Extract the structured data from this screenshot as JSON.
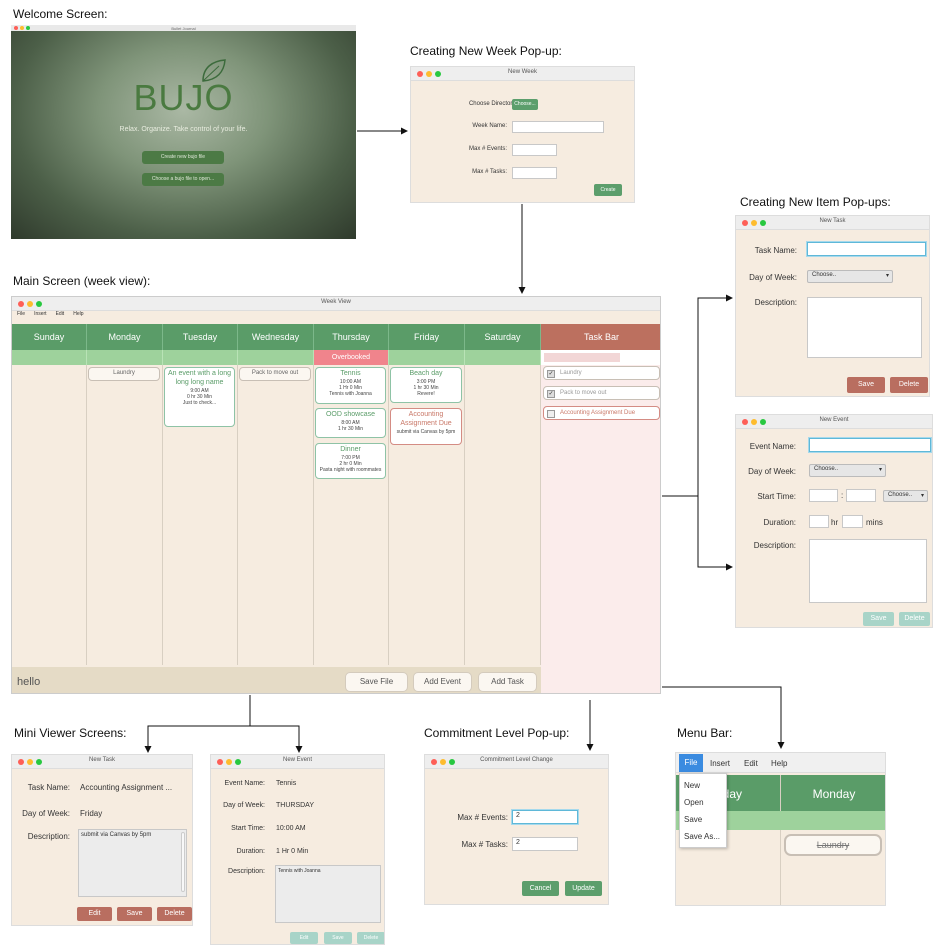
{
  "captions": {
    "welcome": "Welcome Screen:",
    "new_week": "Creating New Week Pop-up:",
    "new_item": "Creating New Item Pop-ups:",
    "main": "Main Screen (week view):",
    "mini": "Mini Viewer Screens:",
    "commit": "Commitment Level Pop-up:",
    "menu": "Menu Bar:"
  },
  "welcome": {
    "title": "Bullet Journal",
    "logo": "BUJO",
    "tagline": "Relax. Organize. Take control of your life.",
    "btn_create": "Create new bujo file",
    "btn_choose": "Choose a bujo file to open..."
  },
  "new_week": {
    "title": "New Week",
    "choose_dir_label": "Choose Directory:",
    "choose_btn": "Choose...",
    "week_name_label": "Week Name:",
    "max_events_label": "Max # Events:",
    "max_tasks_label": "Max # Tasks:",
    "create_btn": "Create"
  },
  "new_task": {
    "title": "New Task",
    "task_name_label": "Task Name:",
    "day_label": "Day of Week:",
    "day_value": "Choose..",
    "desc_label": "Description:",
    "save": "Save",
    "delete": "Delete"
  },
  "new_event": {
    "title": "New Event",
    "event_name_label": "Event Name:",
    "day_label": "Day of Week:",
    "day_value": "Choose..",
    "start_label": "Start Time:",
    "colon": ":",
    "ampm_value": "Choose..",
    "duration_label": "Duration:",
    "hr": "hr",
    "mins": "mins",
    "desc_label": "Description:",
    "save": "Save",
    "delete": "Delete"
  },
  "main": {
    "title": "Week View",
    "menu": [
      "File",
      "Insert",
      "Edit",
      "Help"
    ],
    "days": [
      "Sunday",
      "Monday",
      "Tuesday",
      "Wednesday",
      "Thursday",
      "Friday",
      "Saturday"
    ],
    "overbooked": "Overbooked",
    "taskbar_title": "Task Bar",
    "monday_tasks": [
      "Laundry"
    ],
    "tuesday_event": {
      "title": "An event with a long long long name",
      "time": "9:00 AM",
      "dur": "0 hr 30 Min",
      "desc": "Just to check..."
    },
    "wednesday_tasks": [
      "Pack to move out"
    ],
    "thursday_events": [
      {
        "title": "Tennis",
        "time": "10:00 AM",
        "dur": "1 Hr 0 Min",
        "desc": "Tennis with Joanna"
      },
      {
        "title": "OOD showcase",
        "time": "8:00 AM",
        "dur": "1 hr 30 Min",
        "desc": ""
      },
      {
        "title": "Dinner",
        "time": "7:00 PM",
        "dur": "2 hr 0 Min",
        "desc": "Pasta night with roommates"
      }
    ],
    "friday_event": {
      "title": "Beach day",
      "time": "3:00 PM",
      "dur": "1 hr 30 Min",
      "desc": "Revere!"
    },
    "friday_task": {
      "title": "Accounting Assignment Due",
      "desc": "submit via Canvas by 5pm"
    },
    "taskbar_items": [
      "Laundry",
      "Pack to move out",
      "Accounting Assignment Due"
    ],
    "status": "hello",
    "save_file": "Save File",
    "add_event": "Add Event",
    "add_task": "Add Task"
  },
  "mini_task": {
    "title": "New Task",
    "task_name_label": "Task Name:",
    "task_name": "Accounting Assignment ...",
    "day_label": "Day of Week:",
    "day": "Friday",
    "desc_label": "Description:",
    "desc": "submit via Canvas by 5pm",
    "edit": "Edit",
    "save": "Save",
    "delete": "Delete"
  },
  "mini_event": {
    "title": "New Event",
    "event_name_label": "Event Name:",
    "event_name": "Tennis",
    "day_label": "Day of Week:",
    "day": "THURSDAY",
    "start_label": "Start Time:",
    "start": "10:00 AM",
    "duration_label": "Duration:",
    "duration": "1 Hr 0 Min",
    "desc_label": "Description:",
    "desc": "Tennis with Joanna",
    "edit": "Edit",
    "save": "Save",
    "delete": "Delete"
  },
  "commit": {
    "title": "Commitment Level Change",
    "max_events_label": "Max # Events:",
    "max_events": "2",
    "max_tasks_label": "Max # Tasks:",
    "max_tasks": "2",
    "cancel": "Cancel",
    "update": "Update"
  },
  "menubar": {
    "items": [
      "File",
      "Insert",
      "Edit",
      "Help"
    ],
    "dropdown": [
      "New",
      "Open",
      "Save",
      "Save As..."
    ],
    "col1": "nday",
    "col2": "Monday",
    "task": "Laundry"
  }
}
